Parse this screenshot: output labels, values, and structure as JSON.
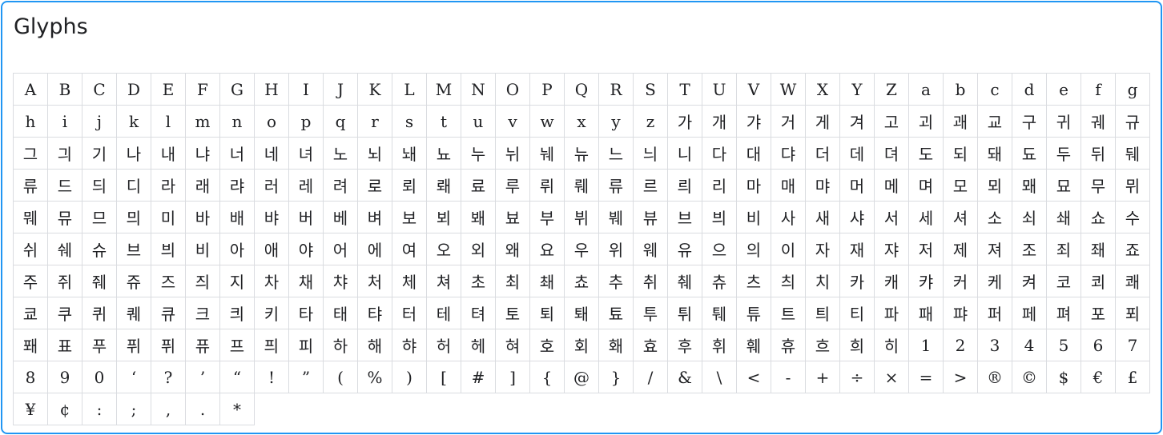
{
  "title": "Glyphs",
  "colors": {
    "border_accent": "#2196f3",
    "grid_line": "#dadce0",
    "text": "#202124"
  },
  "glyphs": [
    "A",
    "B",
    "C",
    "D",
    "E",
    "F",
    "G",
    "H",
    "I",
    "J",
    "K",
    "L",
    "M",
    "N",
    "O",
    "P",
    "Q",
    "R",
    "S",
    "T",
    "U",
    "V",
    "W",
    "X",
    "Y",
    "Z",
    "a",
    "b",
    "c",
    "d",
    "e",
    "f",
    "g",
    "h",
    "i",
    "j",
    "k",
    "l",
    "m",
    "n",
    "o",
    "p",
    "q",
    "r",
    "s",
    "t",
    "u",
    "v",
    "w",
    "x",
    "y",
    "z",
    "가",
    "개",
    "갸",
    "거",
    "게",
    "겨",
    "고",
    "괴",
    "괘",
    "교",
    "구",
    "귀",
    "궤",
    "규",
    "그",
    "긔",
    "기",
    "나",
    "내",
    "냐",
    "너",
    "네",
    "녀",
    "노",
    "뇌",
    "놰",
    "뇨",
    "누",
    "뉘",
    "눼",
    "뉴",
    "느",
    "늬",
    "니",
    "다",
    "대",
    "댜",
    "더",
    "데",
    "뎌",
    "도",
    "되",
    "돼",
    "됴",
    "두",
    "뒤",
    "뒈",
    "류",
    "드",
    "듸",
    "디",
    "라",
    "래",
    "랴",
    "러",
    "레",
    "려",
    "로",
    "뢰",
    "뢔",
    "료",
    "루",
    "뤼",
    "뤠",
    "류",
    "르",
    "릐",
    "리",
    "마",
    "매",
    "먀",
    "머",
    "메",
    "며",
    "모",
    "뫼",
    "뫠",
    "묘",
    "무",
    "뮈",
    "뭬",
    "뮤",
    "므",
    "믜",
    "미",
    "바",
    "배",
    "뱌",
    "버",
    "베",
    "벼",
    "보",
    "뵈",
    "봬",
    "뵤",
    "부",
    "뷔",
    "붸",
    "뷰",
    "브",
    "븨",
    "비",
    "사",
    "새",
    "샤",
    "서",
    "세",
    "셔",
    "소",
    "쇠",
    "쇄",
    "쇼",
    "수",
    "쉬",
    "쉐",
    "슈",
    "브",
    "븨",
    "비",
    "아",
    "애",
    "야",
    "어",
    "에",
    "여",
    "오",
    "외",
    "왜",
    "요",
    "우",
    "위",
    "웨",
    "유",
    "으",
    "의",
    "이",
    "자",
    "재",
    "쟈",
    "저",
    "제",
    "져",
    "조",
    "죄",
    "좨",
    "죠",
    "주",
    "쥐",
    "줴",
    "쥬",
    "즈",
    "즤",
    "지",
    "차",
    "채",
    "챠",
    "처",
    "체",
    "쳐",
    "초",
    "최",
    "쵀",
    "쵸",
    "추",
    "취",
    "췌",
    "츄",
    "츠",
    "츼",
    "치",
    "카",
    "캐",
    "캬",
    "커",
    "케",
    "켜",
    "코",
    "쾨",
    "쾌",
    "쿄",
    "쿠",
    "퀴",
    "퀘",
    "큐",
    "크",
    "킈",
    "키",
    "타",
    "태",
    "탸",
    "터",
    "테",
    "텨",
    "토",
    "퇴",
    "퇘",
    "툐",
    "투",
    "튀",
    "퉤",
    "튜",
    "트",
    "틔",
    "티",
    "파",
    "패",
    "퍄",
    "퍼",
    "페",
    "펴",
    "포",
    "푀",
    "퐤",
    "표",
    "푸",
    "퓌",
    "퓌",
    "퓨",
    "프",
    "픠",
    "피",
    "하",
    "해",
    "햐",
    "허",
    "헤",
    "혀",
    "호",
    "회",
    "홰",
    "효",
    "후",
    "휘",
    "훼",
    "휴",
    "흐",
    "희",
    "히",
    "1",
    "2",
    "3",
    "4",
    "5",
    "6",
    "7",
    "8",
    "9",
    "0",
    "‘",
    "?",
    "’",
    "“",
    "!",
    "”",
    "(",
    "%",
    ")",
    "[",
    "#",
    "]",
    "{",
    "@",
    "}",
    "/",
    "&",
    "\\",
    "<",
    "-",
    "+",
    "÷",
    "×",
    "=",
    ">",
    "®",
    "©",
    "$",
    "€",
    "£",
    "¥",
    "¢",
    ":",
    ";",
    ",",
    ".",
    "*"
  ]
}
